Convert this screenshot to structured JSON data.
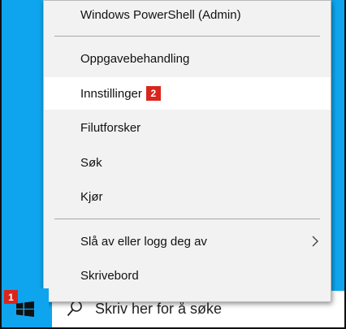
{
  "menu": {
    "items": [
      {
        "label": "Windows PowerShell (Admin)"
      },
      {
        "label": "Oppgavebehandling"
      },
      {
        "label": "Innstillinger",
        "badge": "2"
      },
      {
        "label": "Filutforsker"
      },
      {
        "label": "Søk"
      },
      {
        "label": "Kjør"
      },
      {
        "label": "Slå av eller logg deg av"
      },
      {
        "label": "Skrivebord"
      }
    ]
  },
  "taskbar": {
    "start_badge": "1",
    "search_placeholder": "Skriv her for å søke"
  }
}
